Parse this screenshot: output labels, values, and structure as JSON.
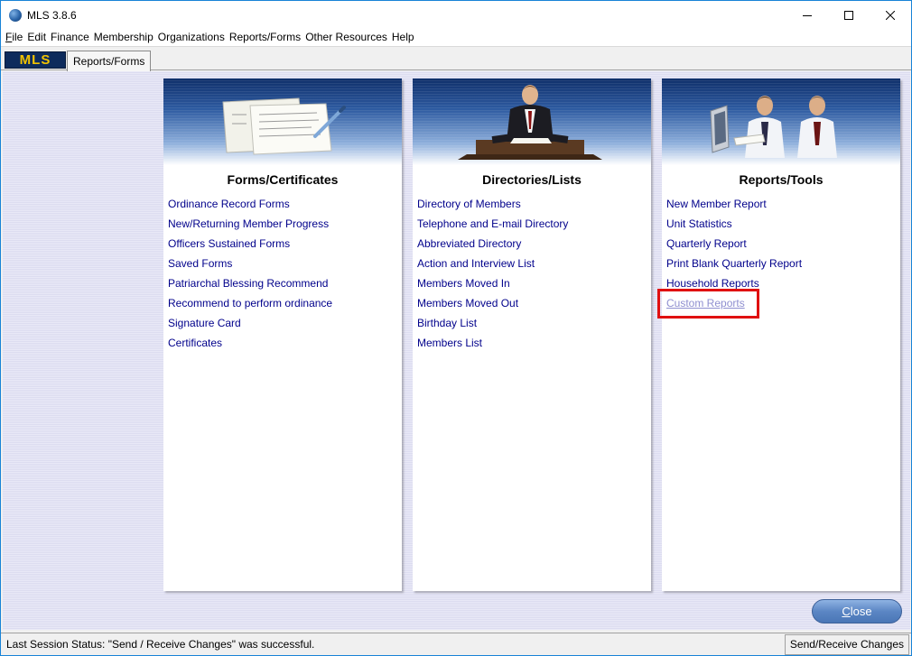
{
  "window": {
    "title": "MLS 3.8.6"
  },
  "menu": [
    {
      "label": "File",
      "key": "F",
      "rest": "ile"
    },
    {
      "label": "Edit"
    },
    {
      "label": "Finance"
    },
    {
      "label": "Membership"
    },
    {
      "label": "Organizations"
    },
    {
      "label": "Reports/Forms"
    },
    {
      "label": "Other Resources"
    },
    {
      "label": "Help"
    }
  ],
  "tabs": {
    "logo": "MLS",
    "active_tab": "Reports/Forms"
  },
  "panels": [
    {
      "title": "Forms/Certificates",
      "links": [
        "Ordinance Record Forms",
        "New/Returning Member Progress",
        "Officers Sustained Forms",
        "Saved Forms",
        "Patriarchal Blessing Recommend",
        "Recommend to perform ordinance",
        "Signature Card",
        "Certificates"
      ]
    },
    {
      "title": "Directories/Lists",
      "links": [
        "Directory of Members",
        "Telephone and E-mail Directory",
        "Abbreviated Directory",
        "Action and Interview List",
        "Members Moved In",
        "Members Moved Out",
        "Birthday List",
        "Members List"
      ]
    },
    {
      "title": "Reports/Tools",
      "links": [
        "New Member Report",
        "Unit Statistics",
        "Quarterly Report",
        "Print Blank Quarterly Report",
        "Household Reports",
        "Custom Reports"
      ]
    }
  ],
  "buttons": {
    "close": {
      "key": "C",
      "rest": "lose"
    },
    "send_receive": "Send/Receive Changes"
  },
  "status": {
    "text": "Last Session Status: \"Send / Receive Changes\" was successful."
  },
  "colors": {
    "link": "#00008b",
    "highlight": "#e01010",
    "logo_bg": "#0d2b5c",
    "logo_text": "#f2c300"
  }
}
